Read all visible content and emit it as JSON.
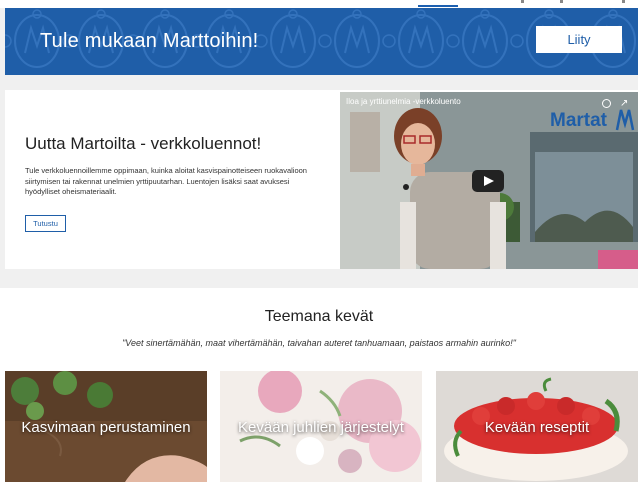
{
  "banner": {
    "title": "Tule mukaan Marttoihin!",
    "join_label": "Liity",
    "color": "#1f5ea8"
  },
  "promo": {
    "title": "Uutta Martoilta - verkkoluennot!",
    "text": "Tule verkkoluennoillemme oppimaan, kuinka aloitat kasvispainotteiseen ruokavalioon siirtymisen tai rakennat unelmien yrttipuutarhan. Luentojen lisäksi saat avuksesi hyödylliset oheismateriaalit.",
    "button_label": "Tutustu"
  },
  "video": {
    "title": "Iloa ja yrttiunelmia -verkkoluento",
    "brand": "Martat"
  },
  "section": {
    "title": "Teemana kevät",
    "quote": "\"Veet sinertämähän, maat vihertämähän, taivahan auteret tanhuamaan, paistaos armahin aurinko!\""
  },
  "cards": [
    {
      "label": "Kasvimaan perustaminen"
    },
    {
      "label": "Kevään juhlien järjestelyt"
    },
    {
      "label": "Kevään reseptit"
    }
  ]
}
